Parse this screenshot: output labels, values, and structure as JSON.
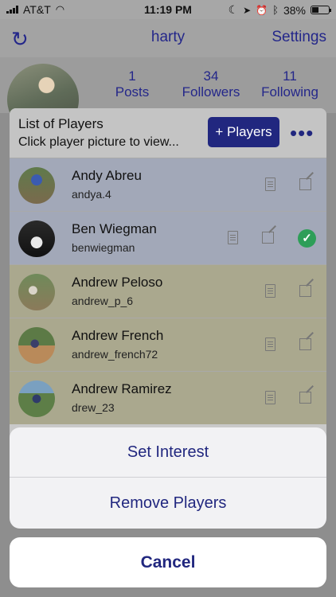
{
  "status_bar": {
    "carrier": "AT&T",
    "time": "11:19 PM",
    "battery": "38%",
    "battery_level": 0.38,
    "icons": [
      "signal-icon",
      "wifi-icon",
      "moon-icon",
      "location-icon",
      "alarm-icon",
      "bluetooth-icon",
      "battery-icon"
    ]
  },
  "header": {
    "refresh_icon": "refresh-icon",
    "title": "harty",
    "settings_label": "Settings"
  },
  "profile": {
    "posts_count": "1",
    "posts_label": "Posts",
    "followers_count": "34",
    "followers_label": "Followers",
    "following_count": "11",
    "following_label": "Following"
  },
  "player_list": {
    "title": "List of Players",
    "subtitle": "Click player picture to view...",
    "add_button_label": "+ Players",
    "more_label": "•••",
    "players": [
      {
        "name": "Andy Abreu",
        "username": "andya.4",
        "selected": true,
        "checked": false
      },
      {
        "name": "Ben Wiegman",
        "username": "benwiegman",
        "selected": true,
        "checked": true
      },
      {
        "name": "Andrew Peloso",
        "username": "andrew_p_6",
        "selected": false,
        "checked": false
      },
      {
        "name": "Andrew French",
        "username": "andrew_french72",
        "selected": false,
        "checked": false
      },
      {
        "name": "Andrew Ramirez",
        "username": "drew_23",
        "selected": false,
        "checked": false
      }
    ]
  },
  "action_sheet": {
    "set_interest_label": "Set Interest",
    "remove_players_label": "Remove Players",
    "cancel_label": "Cancel"
  },
  "colors": {
    "accent": "#21277f",
    "check_green": "#2e9e58"
  }
}
